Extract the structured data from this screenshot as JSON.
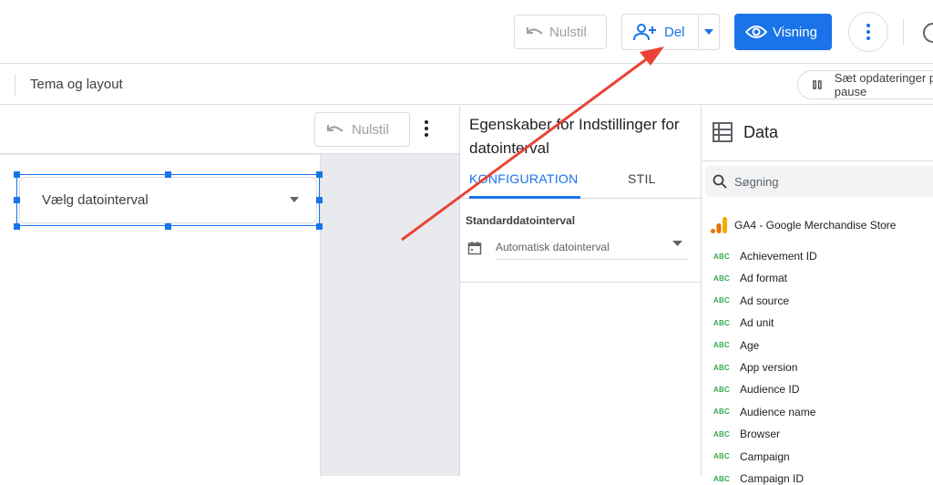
{
  "header": {
    "reset_label": "Nulstil",
    "share_label": "Del",
    "view_label": "Visning"
  },
  "toolbar": {
    "theme_label": "Tema og layout",
    "pause_label": "Sæt opdateringer på pause"
  },
  "canvas": {
    "reset_label": "Nulstil",
    "date_control_label": "Vælg datointerval"
  },
  "properties": {
    "title": "Egenskaber for Indstillinger for datointerval",
    "tabs": [
      {
        "label": "KONFIGURATION",
        "active": true
      },
      {
        "label": "STIL",
        "active": false
      }
    ],
    "default_range_label": "Standarddatointerval",
    "default_range_value": "Automatisk datointerval"
  },
  "data_panel": {
    "title": "Data",
    "search_placeholder": "Søgning",
    "source_name": "GA4 - Google Merchandise Store",
    "field_type_tag": "ABC",
    "fields": [
      "Achievement ID",
      "Ad format",
      "Ad source",
      "Ad unit",
      "Age",
      "App version",
      "Audience ID",
      "Audience name",
      "Browser",
      "Campaign",
      "Campaign ID"
    ]
  },
  "colors": {
    "accent": "#1a73e8",
    "dimension_tag": "#34a853",
    "annotation_arrow": "#ea4335",
    "source_icon": "#f9ab00"
  }
}
